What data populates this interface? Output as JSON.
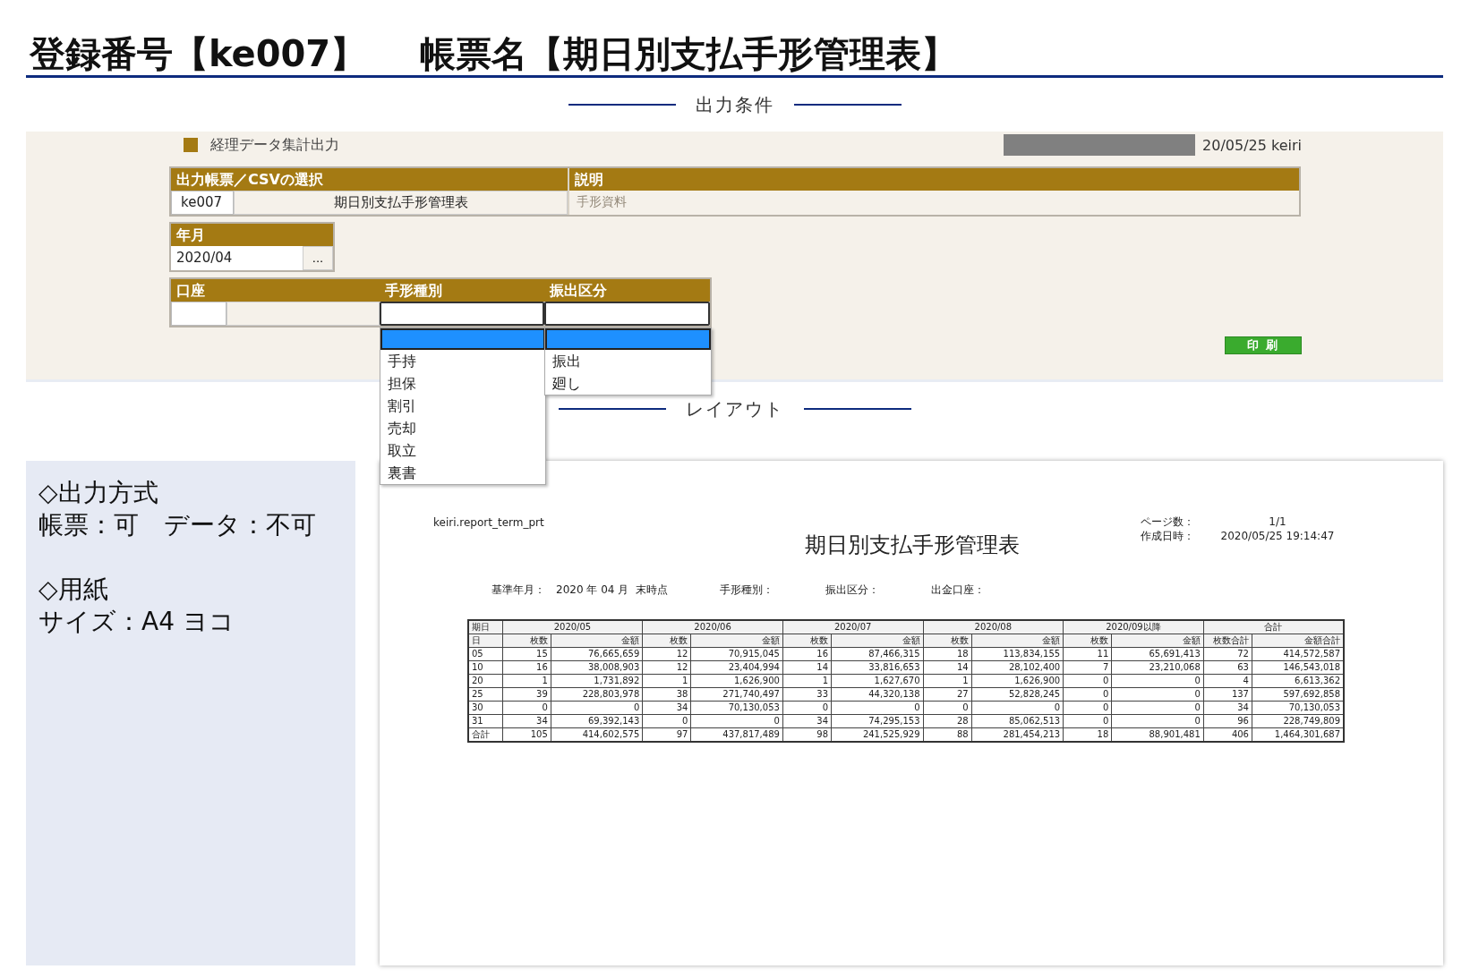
{
  "title": {
    "registration": "登録番号【ke007】",
    "form_name": "帳票名【期日別支払手形管理表】"
  },
  "conditions_heading": "出力条件",
  "panel": {
    "heading": "経理データ集計出力",
    "user_info": "20/05/25 keiri",
    "report_select": {
      "headers": [
        "出力帳票／CSVの選択",
        "説明"
      ],
      "code": "ke007",
      "name": "期日別支払手形管理表",
      "description": "手形資料"
    },
    "year_month": {
      "label": "年月",
      "value": "2020/04",
      "button": "..."
    },
    "filters": {
      "headers": [
        "口座",
        "手形種別",
        "振出区分"
      ]
    },
    "dropdowns": [
      {
        "blank_option_selected": true,
        "options": [
          "手持",
          "担保",
          "割引",
          "売却",
          "取立",
          "裏書"
        ]
      },
      {
        "blank_option_selected": true,
        "options": [
          "振出",
          "廻し"
        ]
      }
    ],
    "print_button": "印 刷"
  },
  "layout_heading": "レイアウト",
  "output_info": [
    {
      "heading": "◇出力方式",
      "text": "帳票：可　データ：不可"
    },
    {
      "heading": "◇用紙",
      "text": "サイズ：A4 ヨコ"
    }
  ],
  "report": {
    "program": "keiri.report_term_prt",
    "title": "期日別支払手形管理表",
    "meta": [
      {
        "label": "ページ数：",
        "value": "1/1"
      },
      {
        "label": "作成日時：",
        "value": "2020/05/25 19:14:47"
      }
    ],
    "criteria": [
      {
        "label": "基準年月：",
        "value": "2020 年 04 月  末時点"
      },
      {
        "label": "手形種別："
      },
      {
        "label": "振出区分："
      },
      {
        "label": "出金口座："
      }
    ],
    "table": {
      "group_headers": [
        "期日",
        "2020/05",
        "2020/06",
        "2020/07",
        "2020/08",
        "2020/09以降",
        "合計"
      ],
      "sub_headers": [
        "日",
        "枚数",
        "金額",
        "枚数",
        "金額",
        "枚数",
        "金額",
        "枚数",
        "金額",
        "枚数",
        "金額",
        "枚数合計",
        "金額合計"
      ],
      "rows": [
        [
          "05",
          "15",
          "76,665,659",
          "12",
          "70,915,045",
          "16",
          "87,466,315",
          "18",
          "113,834,155",
          "11",
          "65,691,413",
          "72",
          "414,572,587"
        ],
        [
          "10",
          "16",
          "38,008,903",
          "12",
          "23,404,994",
          "14",
          "33,816,653",
          "14",
          "28,102,400",
          "7",
          "23,210,068",
          "63",
          "146,543,018"
        ],
        [
          "20",
          "1",
          "1,731,892",
          "1",
          "1,626,900",
          "1",
          "1,627,670",
          "1",
          "1,626,900",
          "0",
          "0",
          "4",
          "6,613,362"
        ],
        [
          "25",
          "39",
          "228,803,978",
          "38",
          "271,740,497",
          "33",
          "44,320,138",
          "27",
          "52,828,245",
          "0",
          "0",
          "137",
          "597,692,858"
        ],
        [
          "30",
          "0",
          "0",
          "34",
          "70,130,053",
          "0",
          "0",
          "0",
          "0",
          "0",
          "0",
          "34",
          "70,130,053"
        ],
        [
          "31",
          "34",
          "69,392,143",
          "0",
          "0",
          "34",
          "74,295,153",
          "28",
          "85,062,513",
          "0",
          "0",
          "96",
          "228,749,809"
        ],
        [
          "合計",
          "105",
          "414,602,575",
          "97",
          "437,817,489",
          "98",
          "241,525,929",
          "88",
          "281,454,213",
          "18",
          "88,901,481",
          "406",
          "1,464,301,687"
        ]
      ]
    }
  }
}
